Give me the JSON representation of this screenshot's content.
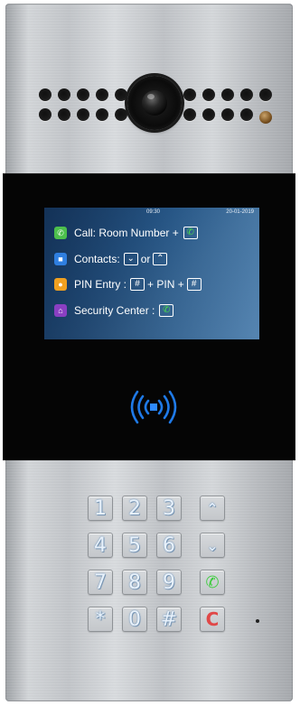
{
  "status_bar": {
    "time": "09:30",
    "date": "20-01-2019"
  },
  "instructions": {
    "call": {
      "label": "Call: Room Number +",
      "key_icon": "phone-handset-icon"
    },
    "contacts": {
      "label": "Contacts:",
      "middle": "or",
      "keys": [
        "chevron-down-icon",
        "chevron-up-icon"
      ]
    },
    "pin": {
      "label": "PIN Entry :",
      "middle": "+ PIN +",
      "key": "#"
    },
    "security": {
      "label": "Security Center :",
      "key_icon": "phone-handset-icon"
    }
  },
  "keypad": {
    "keys": [
      "1",
      "2",
      "3",
      "^",
      "4",
      "5",
      "6",
      "v",
      "7",
      "8",
      "9",
      "call",
      "*",
      "0",
      "#",
      "C"
    ],
    "cancel_label": "C"
  },
  "colors": {
    "screen_blue": "#2b5f92",
    "call_green": "#3ccc3c",
    "cancel_red": "#e04848",
    "nfc_blue": "#1f7ae8"
  }
}
